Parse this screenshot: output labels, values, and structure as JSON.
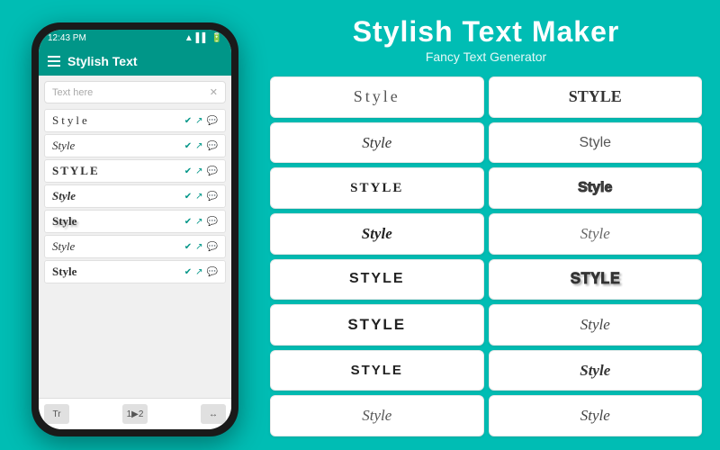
{
  "header": {
    "title": "Stylish Text Maker",
    "subtitle": "Fancy Text Generator"
  },
  "phone": {
    "status_time": "12:43 PM",
    "status_signal": "▲▲▲",
    "toolbar_title": "Stylish Text",
    "search_placeholder": "Text here",
    "list_items": [
      {
        "text": "Style",
        "font_class": "font-thin"
      },
      {
        "text": "Style",
        "font_class": "font-italic-script"
      },
      {
        "text": "STYLE",
        "font_class": "font-blackletter"
      },
      {
        "text": "Style",
        "font_class": "font-cursive-bold"
      },
      {
        "text": "Style",
        "font_class": "font-shadow"
      },
      {
        "text": "Style",
        "font_class": "font-decorative"
      },
      {
        "text": "Style",
        "font_class": "font-bold-serif"
      }
    ],
    "bottom_icons": [
      "Tr",
      "1>2",
      "<->"
    ]
  },
  "style_cards": [
    {
      "text": "Style",
      "font_class": "font-thin"
    },
    {
      "text": "STYLE",
      "font_class": "font-bold-serif"
    },
    {
      "text": "Style",
      "font_class": "font-italic-script"
    },
    {
      "text": "Style",
      "font_class": "font-normal-sans"
    },
    {
      "text": "STYLE",
      "font_class": "font-blackletter"
    },
    {
      "text": "Style",
      "font_class": "font-outlined"
    },
    {
      "text": "Style",
      "font_class": "font-cursive-bold"
    },
    {
      "text": "Style",
      "font_class": "font-italic-thin"
    },
    {
      "text": "Style",
      "font_class": "font-bold-wide"
    },
    {
      "text": "Style",
      "font_class": "font-shadow"
    },
    {
      "text": "STYLE",
      "font_class": "font-small-caps"
    },
    {
      "text": "STYLE",
      "font_class": "font-stamp"
    },
    {
      "text": "STYLE",
      "font_class": "font-bold-wide"
    },
    {
      "text": "Style",
      "font_class": "font-italic-serif2"
    },
    {
      "text": "Style",
      "font_class": "font-decorative"
    },
    {
      "text": "Style",
      "font_class": "font-italic-thin"
    }
  ]
}
